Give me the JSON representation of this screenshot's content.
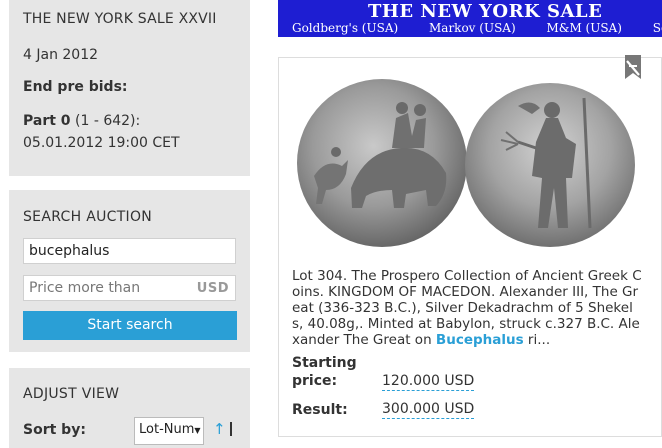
{
  "sale": {
    "title": "THE NEW YORK SALE XXVII",
    "date": "4 Jan 2012",
    "prebids_label": "End pre bids:",
    "part_label": "Part 0",
    "part_range": "(1 - 642):",
    "part_end": "05.01.2012 19:00 CET"
  },
  "search": {
    "heading": "SEARCH AUCTION",
    "query": "bucephalus",
    "price_placeholder": "Price more than",
    "currency": "USD",
    "button_label": "Start search"
  },
  "adjust": {
    "heading": "ADJUST VIEW",
    "sort_label": "Sort by:",
    "sort_value": "Lot-Num",
    "sort_arrow_icon": "sort-arrow-icon"
  },
  "banner": {
    "title": "THE NEW YORK SALE",
    "links": [
      "Goldberg's (USA)",
      "Markov (USA)",
      "M&M (USA)",
      "Sovereign"
    ],
    "color": "#1e1ed2"
  },
  "lot": {
    "description_prefix": "Lot 304. The Prospero Collection of Ancient Greek Coins. KINGDOM OF MACEDON. Alexander III, The Great (336-323 B.C.), Silver Dekadrachm of 5 Shekels, 40.08g,. Minted at Babylon, struck c.327 B.C. Alexander The Great on ",
    "description_highlight": "Bucephalus",
    "description_suffix": " ri...",
    "starting_price_label_1": "Starting",
    "starting_price_label_2": "price:",
    "starting_price": "120.000 USD",
    "result_label": "Result:",
    "result": "300.000 USD",
    "bookmark_icon": "bookmark-off-icon",
    "accent_color": "#2a9fd6"
  }
}
